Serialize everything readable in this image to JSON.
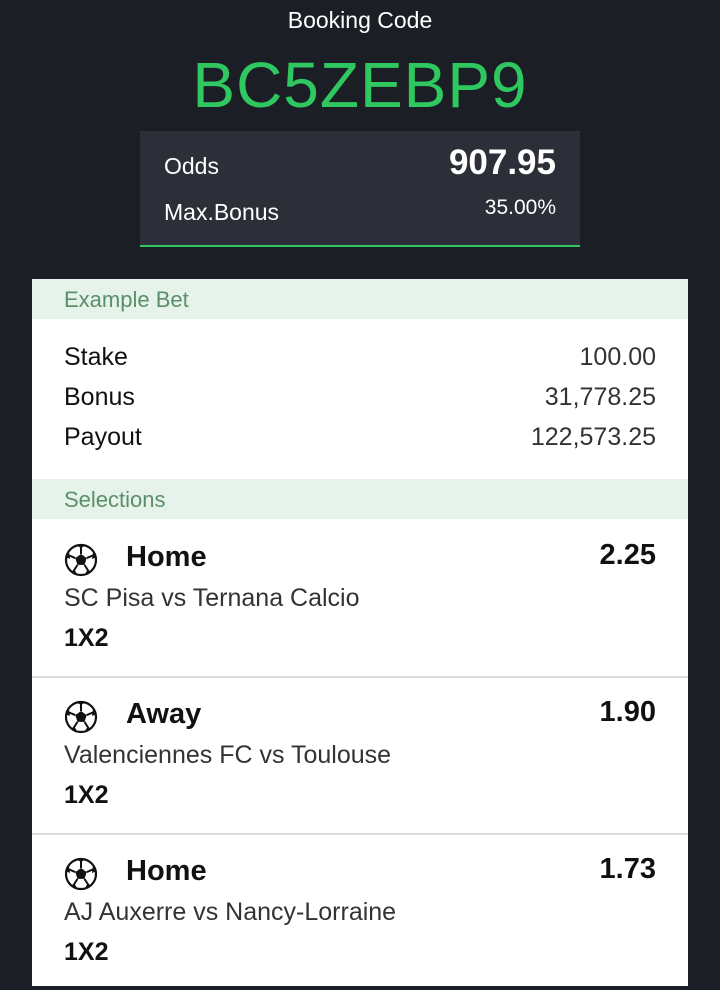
{
  "booking": {
    "label": "Booking Code",
    "code": "BC5ZEBP9"
  },
  "summary": {
    "odds_label": "Odds",
    "odds_value": "907.95",
    "max_bonus_label": "Max.Bonus",
    "max_bonus_value": "35.00%"
  },
  "example_bet": {
    "title": "Example Bet",
    "rows": [
      {
        "label": "Stake",
        "value": "100.00"
      },
      {
        "label": "Bonus",
        "value": "31,778.25"
      },
      {
        "label": "Payout",
        "value": "122,573.25"
      }
    ]
  },
  "selections": {
    "title": "Selections",
    "items": [
      {
        "icon": "soccer-ball-icon",
        "pick": "Home",
        "odds": "2.25",
        "match": "SC Pisa vs Ternana Calcio",
        "market": "1X2"
      },
      {
        "icon": "soccer-ball-icon",
        "pick": "Away",
        "odds": "1.90",
        "match": "Valenciennes FC vs Toulouse",
        "market": "1X2"
      },
      {
        "icon": "soccer-ball-icon",
        "pick": "Home",
        "odds": "1.73",
        "match": "AJ Auxerre vs Nancy-Lorraine",
        "market": "1X2"
      }
    ]
  },
  "colors": {
    "background": "#1b1e24",
    "accent": "#2fc760",
    "section_header_bg": "#e6f3ea",
    "section_header_text": "#5b8e6b"
  }
}
